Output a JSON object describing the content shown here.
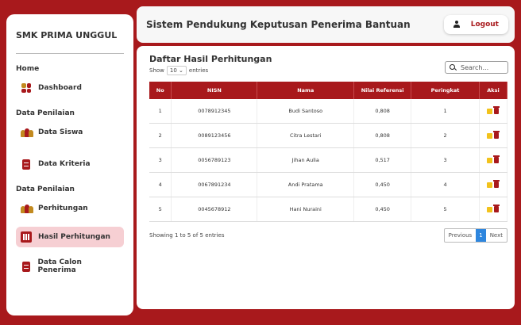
{
  "sidebar": {
    "brand": "SMK PRIMA UNGGUL",
    "sections": [
      {
        "title": "Home"
      },
      {
        "title": "Data Penilaian"
      },
      {
        "title": "Data Penilaian"
      }
    ],
    "items": [
      {
        "label": "Dashboard",
        "icon": "dashboard-icon"
      },
      {
        "label": "Data Siswa",
        "icon": "users-icon"
      },
      {
        "label": "Data Kriteria",
        "icon": "document-icon"
      },
      {
        "label": "Perhitungan",
        "icon": "users-icon"
      },
      {
        "label": "Hasil Perhitungan",
        "icon": "chart-icon"
      },
      {
        "label": "Data Calon Penerima",
        "icon": "document-icon"
      }
    ]
  },
  "header": {
    "title": "Sistem Pendukung Keputusan Penerima Bantuan",
    "logout_label": "Logout"
  },
  "main": {
    "title": "Daftar Hasil Perhitungan",
    "show_label": "Show",
    "entries_value": "10",
    "entries_label": "entries",
    "search_placeholder": "Search...",
    "columns": [
      "No",
      "NISN",
      "Nama",
      "Nilai Referensi",
      "Peringkat",
      "Aksi"
    ],
    "rows": [
      {
        "no": "1",
        "nisn": "0078912345",
        "nama": "Budi Santoso",
        "nilai": "0,808",
        "peringkat": "1"
      },
      {
        "no": "2",
        "nisn": "0089123456",
        "nama": "Citra Lestari",
        "nilai": "0,808",
        "peringkat": "2"
      },
      {
        "no": "3",
        "nisn": "0056789123",
        "nama": "Jihan Aulia",
        "nilai": "0,517",
        "peringkat": "3"
      },
      {
        "no": "4",
        "nisn": "0067891234",
        "nama": "Andi Pratama",
        "nilai": "0,450",
        "peringkat": "4"
      },
      {
        "no": "5",
        "nisn": "0045678912",
        "nama": "Hani Nuraini",
        "nilai": "0,450",
        "peringkat": "5"
      }
    ],
    "footer_info": "Showing 1 to 5 of 5 entries",
    "pagination": {
      "previous": "Previous",
      "current": "1",
      "next": "Next"
    }
  },
  "colors": {
    "accent": "#a8191c",
    "active_bg": "#f6cfd3",
    "edit": "#f2c21b",
    "page_active": "#2e86de"
  }
}
